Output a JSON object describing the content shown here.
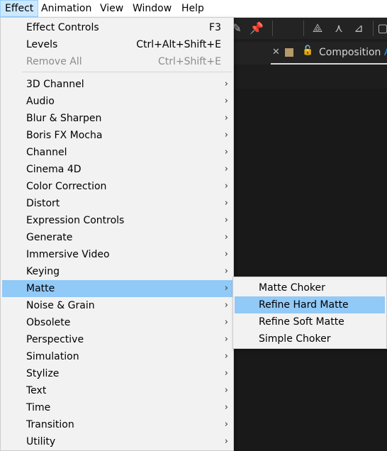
{
  "menubar": {
    "items": [
      "Effect",
      "Animation",
      "View",
      "Window",
      "Help"
    ]
  },
  "tab": {
    "label": "Composition",
    "comp_name": "AE"
  },
  "menu": {
    "top_items": [
      {
        "label": "Effect Controls",
        "shortcut": "F3",
        "disabled": false
      },
      {
        "label": "Levels",
        "shortcut": "Ctrl+Alt+Shift+E",
        "disabled": false
      },
      {
        "label": "Remove All",
        "shortcut": "Ctrl+Shift+E",
        "disabled": true
      }
    ],
    "categories": [
      "3D Channel",
      "Audio",
      "Blur & Sharpen",
      "Boris FX Mocha",
      "Channel",
      "Cinema 4D",
      "Color Correction",
      "Distort",
      "Expression Controls",
      "Generate",
      "Immersive Video",
      "Keying",
      "Matte",
      "Noise & Grain",
      "Obsolete",
      "Perspective",
      "Simulation",
      "Stylize",
      "Text",
      "Time",
      "Transition",
      "Utility"
    ],
    "highlighted_category": "Matte",
    "submenu_arrow": "›"
  },
  "submenu": {
    "items": [
      "Matte Choker",
      "Refine Hard Matte",
      "Refine Soft Matte",
      "Simple Choker"
    ],
    "highlighted": "Refine Hard Matte"
  },
  "colors": {
    "highlight": "#91c9f7",
    "menu_bg": "#f2f2f2",
    "comp_accent": "#2d8ceb"
  }
}
